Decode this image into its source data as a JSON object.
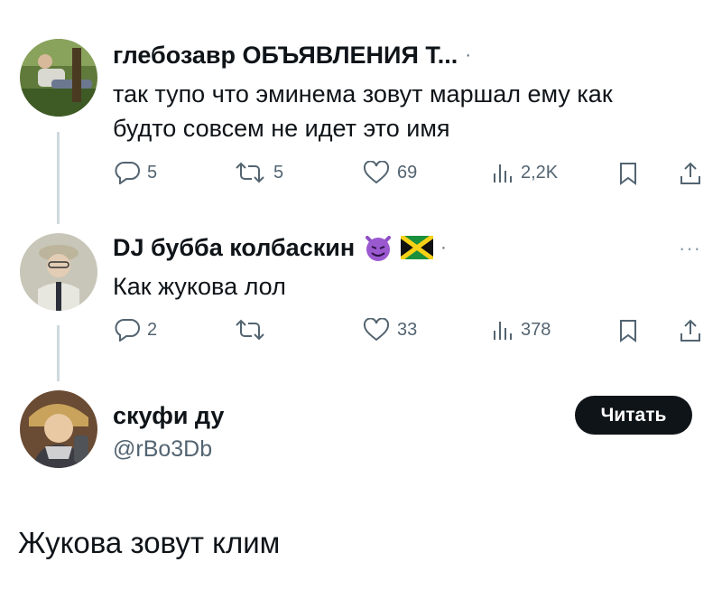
{
  "tweet1": {
    "author": "глебозавр ОБЪЯВЛЕНИЯ Т...",
    "separator": "·",
    "text_line1": "так тупо что эминема зовут маршал ему как",
    "text_line2": "будто совсем не идет это имя",
    "actions": {
      "replies": "5",
      "retweets": "5",
      "likes": "69",
      "views": "2,2K"
    }
  },
  "tweet2": {
    "author": "DJ бубба колбаскин",
    "emojis": [
      "devil-face",
      "jamaica-flag"
    ],
    "separator": "·",
    "more": "···",
    "text": "Как жукова лол",
    "actions": {
      "replies": "2",
      "retweets": "",
      "likes": "33",
      "views": "378"
    }
  },
  "main": {
    "author": "скуфи ду",
    "handle": "@rBo3Db",
    "follow_label": "Читать",
    "text": "Жукова зовут клим"
  },
  "colors": {
    "text": "#0f1419",
    "secondary": "#536471",
    "thread_line": "#cfd9de",
    "button_bg": "#0f1419"
  }
}
